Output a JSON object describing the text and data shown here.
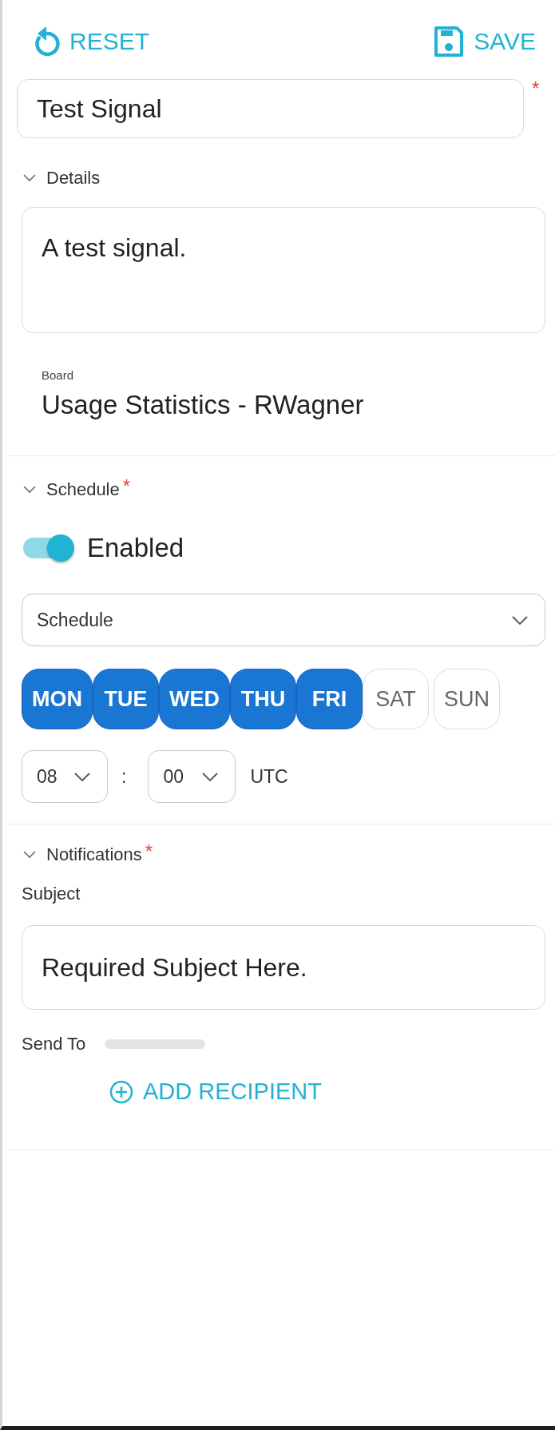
{
  "toolbar": {
    "reset": "RESET",
    "save": "SAVE"
  },
  "name_field": {
    "value": "Test Signal",
    "required_mark": "*"
  },
  "details": {
    "title": "Details",
    "expanded": true,
    "description": "A test signal.",
    "board_label": "Board",
    "board": "Usage Statistics - RWagner"
  },
  "schedule": {
    "title": "Schedule",
    "required_mark": "*",
    "expanded": true,
    "toggle": {
      "label": "Enabled",
      "on": true
    },
    "select": {
      "value": "Schedule"
    },
    "days": [
      {
        "label": "MON",
        "selected": true
      },
      {
        "label": "TUE",
        "selected": true
      },
      {
        "label": "WED",
        "selected": true
      },
      {
        "label": "THU",
        "selected": true
      },
      {
        "label": "FRI",
        "selected": true
      },
      {
        "label": "SAT",
        "selected": false
      },
      {
        "label": "SUN",
        "selected": false
      }
    ],
    "hour": "08",
    "separator": ":",
    "minute": "00",
    "timezone": "UTC"
  },
  "notifications": {
    "title": "Notifications",
    "required_mark": "*",
    "expanded": true,
    "subject_label": "Subject",
    "subject": "Required Subject Here.",
    "send_to_label": "Send To",
    "add_recipient": "ADD RECIPIENT"
  }
}
